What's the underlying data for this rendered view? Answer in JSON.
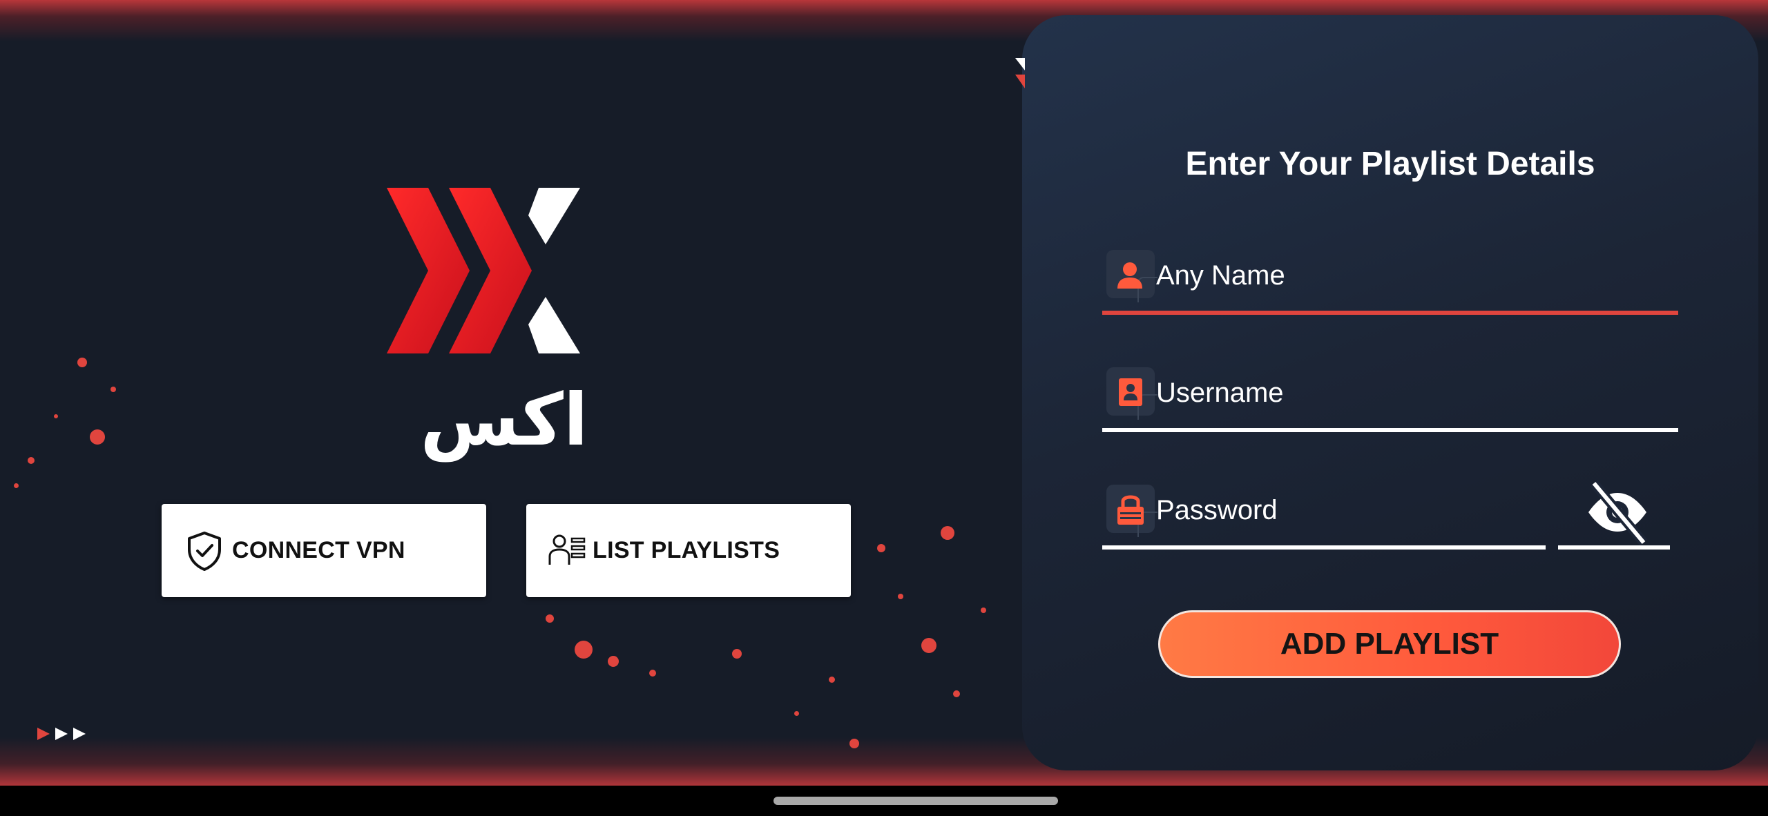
{
  "brand": {
    "logo_text": "اكس"
  },
  "actions": {
    "connect_vpn": "CONNECT VPN",
    "list_playlists": "LIST PLAYLISTS"
  },
  "form": {
    "title": "Enter Your Playlist Details",
    "name_placeholder": "Any Name",
    "username_placeholder": "Username",
    "password_placeholder": "Password",
    "submit_label": "ADD PLAYLIST"
  },
  "icons": {
    "name": "person-icon",
    "username": "id-card-icon",
    "password": "lock-icon",
    "visibility": "eye-off-icon",
    "vpn": "shield-check-icon",
    "playlists": "user-list-icon"
  },
  "colors": {
    "accent": "#ff5a3c",
    "active_underline": "#e0453e",
    "panel": "#1c2536",
    "background": "#161c28"
  }
}
